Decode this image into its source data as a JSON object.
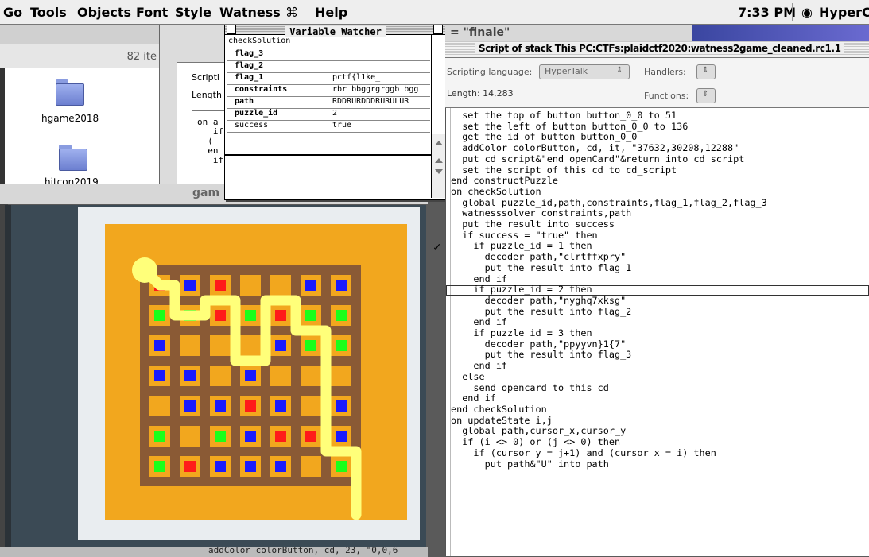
{
  "menubar": {
    "items": [
      "Go",
      "Tools",
      "Objects",
      "Font",
      "Style",
      "Watness",
      "⌘",
      "Help"
    ],
    "clock": "7:33 PM",
    "app_name": "HyperCa"
  },
  "finder": {
    "item_count": "82 ite",
    "folders": [
      "hgame2018",
      "hitcon2019"
    ]
  },
  "background_script": {
    "label_scripting": "Scripti",
    "label_length": "Length",
    "code_lines": [
      "on a",
      "   if",
      "  (",
      "  en",
      "   if"
    ],
    "bottom_line": "addColor colorButton, cd, 23, \"0,0,6"
  },
  "game_window": {
    "title": "gam"
  },
  "watcher": {
    "title": "Variable Watcher",
    "handler": "checkSolution",
    "rows": [
      {
        "name": "flag_3",
        "value": ""
      },
      {
        "name": "flag_2",
        "value": ""
      },
      {
        "name": "flag_1",
        "value": "pctf{l1ke_"
      },
      {
        "name": "constraints",
        "value": "rbr bbggrgrggb bgg"
      },
      {
        "name": "path",
        "value": "RDDRURDDDRURULUR"
      },
      {
        "name": "puzzle_id",
        "value": "2"
      },
      {
        "name": "success",
        "value": "true"
      }
    ]
  },
  "script_editor": {
    "tab_title": "= \"finale\"",
    "window_title": "Script of stack This PC:CTFs:plaidctf2020:watness2game_cleaned.rc1.1",
    "language_label": "Scripting language:",
    "language_value": "HyperTalk",
    "handlers_label": "Handlers:",
    "functions_label": "Functions:",
    "length_label": "Length: 14,283",
    "code": [
      "",
      "  set the top of button button_0_0 to 51",
      "  set the left of button button_0_0 to 136",
      "",
      "  get the id of button button_0_0",
      "  addColor colorButton, cd, it, \"37632,30208,12288\"",
      "",
      "  put cd_script&\"end openCard\"&return into cd_script",
      "  set the script of this cd to cd_script",
      "",
      "end constructPuzzle",
      "",
      "on checkSolution",
      "  global puzzle_id,path,constraints,flag_1,flag_2,flag_3",
      "  watnesssolver constraints,path",
      "  put the result into success",
      "  if success = \"true\" then",
      "    if puzzle_id = 1 then",
      "      decoder path,\"clrtffxpry\"",
      "      put the result into flag_1",
      "    end if",
      "    if puzzle_id = 2 then",
      "      decoder path,\"nyghq7xksg\"",
      "      put the result into flag_2",
      "    end if",
      "    if puzzle_id = 3 then",
      "      decoder path,\"ppyyvn}1{7\"",
      "      put the result into flag_3",
      "    end if",
      "  else",
      "    send opencard to this cd",
      "  end if",
      "end checkSolution",
      "",
      "",
      "on updateState i,j",
      "  global path,cursor_x,cursor_y",
      "",
      "  if (i <> 0) or (j <> 0) then",
      "    if (cursor_y = j+1) and (cursor_x = i) then",
      "      put path&\"U\" into path"
    ]
  },
  "puzzle": {
    "colors": {
      "red": "#ff1a1a",
      "blue": "#1a1aff",
      "green": "#1aff1a",
      "board": "#f2a71e",
      "grid": "#8a5a35",
      "path": "#ffff7a"
    },
    "cells": [
      [
        "r",
        "b",
        "r",
        "",
        "",
        "b",
        "b"
      ],
      [
        "g",
        "g",
        "r",
        "g",
        "r",
        "g",
        "g"
      ],
      [
        "b",
        "",
        "",
        "",
        "b",
        "g",
        "g"
      ],
      [
        "b",
        "b",
        "",
        "b",
        "",
        "",
        ""
      ],
      [
        "",
        "b",
        "b",
        "r",
        "b",
        "",
        "b"
      ],
      [
        "g",
        "",
        "g",
        "b",
        "r",
        "r",
        "b"
      ],
      [
        "g",
        "r",
        "b",
        "b",
        "b",
        "",
        "g"
      ]
    ]
  }
}
